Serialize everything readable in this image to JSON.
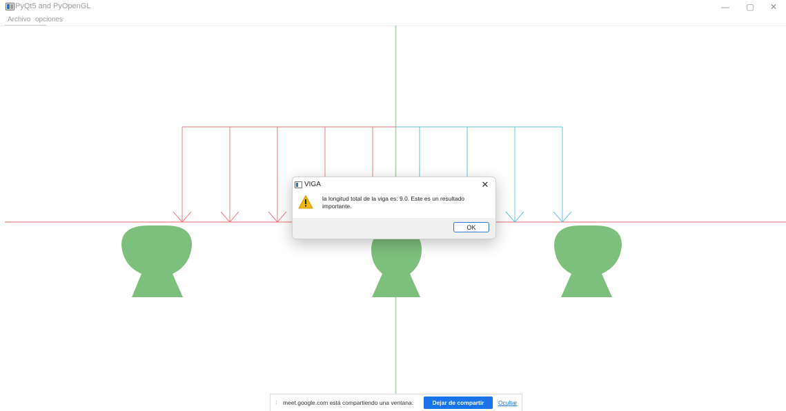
{
  "window": {
    "title": "PyQt5 and PyOpenGL",
    "minimize_glyph": "—",
    "maximize_glyph": "▢",
    "close_glyph": "✕"
  },
  "menu": {
    "items": [
      "Archivo",
      "opciones"
    ]
  },
  "dialog": {
    "title": "VIGA",
    "close_glyph": "✕",
    "message": "la longitud total de la viga es: 9.0. Este es un resultado importante.",
    "ok_label": "OK",
    "icon": "warning-icon"
  },
  "share_bar": {
    "grip": "⁞",
    "text": "meet.google.com está compartiendo una ventana.",
    "stop_label": "Dejar de compartir",
    "hide_label": "Ocultar"
  },
  "colors": {
    "beam": "#e8656b",
    "load_left": "#ef7a80",
    "load_right": "#63c4e0",
    "axis": "#8fdf8f",
    "support": "#7dbf7d",
    "accent": "#1a73e8"
  }
}
